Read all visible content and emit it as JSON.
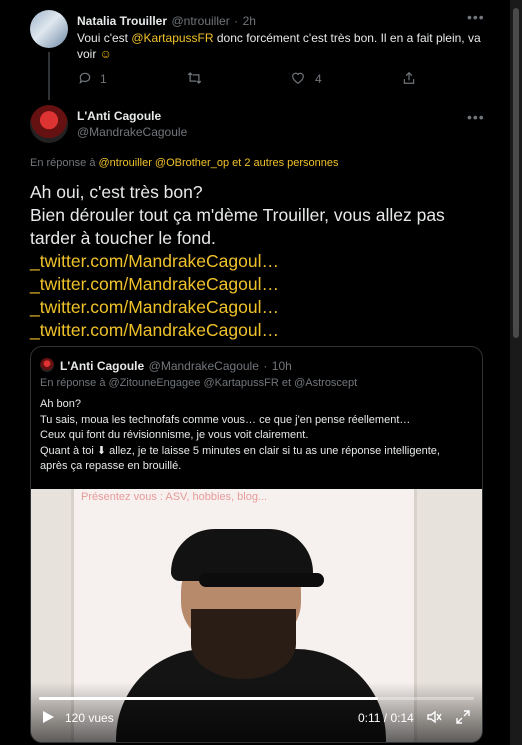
{
  "tweet1": {
    "name": "Natalia Trouiller",
    "handle": "@ntrouiller",
    "dot": "·",
    "time": "2h",
    "text_a": "Voui c'est ",
    "mention": "@KartapussFR",
    "text_b": " donc forcément c'est très bon. Il en a fait plein, va voir ",
    "emoji": "☺",
    "reply_count": "1",
    "like_count": "4"
  },
  "tweet2": {
    "name": "L'Anti Cagoule",
    "handle": "@MandrakeCagoule",
    "reply_prefix": "En réponse à ",
    "reply_mentions": "@ntrouiller @OBrother_op",
    "reply_suffix": " et 2 autres personnes",
    "text_line1": "Ah oui, c'est très bon?",
    "text_line2": "Bien dérouler tout ça m'dème Trouiller, vous allez pas tarder à toucher le fond.",
    "links": [
      "_twitter.com/MandrakeCagoul…",
      "_twitter.com/MandrakeCagoul…",
      "_twitter.com/MandrakeCagoul…",
      "_twitter.com/MandrakeCagoul…"
    ]
  },
  "quote": {
    "name": "L'Anti Cagoule",
    "handle": "@MandrakeCagoule",
    "dot": "·",
    "time": "10h",
    "reply_line": "En réponse à @ZitouneEngagee @KartapussFR  et  @Astroscept",
    "lines": [
      "Ah bon?",
      "Tu sais, moua les technofafs comme vous… ce que j'en pense réellement…",
      "Ceux qui font du révisionnisme, je vous voit clairement.",
      "Quant à toi ⬇ allez, je te laisse 5 minutes en clair si tu as une réponse intelligente, après ça repasse en brouillé."
    ],
    "video": {
      "caption": "Présentez vous : ASV, hobbies, blog...",
      "views": "120 vues",
      "time": "0:11 / 0:14",
      "progress": 0.78
    }
  },
  "icons": {
    "more": "more-icon",
    "reply": "reply-icon",
    "retweet": "retweet-icon",
    "like": "like-icon",
    "share": "share-icon",
    "play": "play-icon",
    "volume": "volume-icon",
    "fullscreen": "fullscreen-icon"
  },
  "colors": {
    "accent": "#f0c22a",
    "background": "#000000",
    "muted": "#71767b"
  }
}
